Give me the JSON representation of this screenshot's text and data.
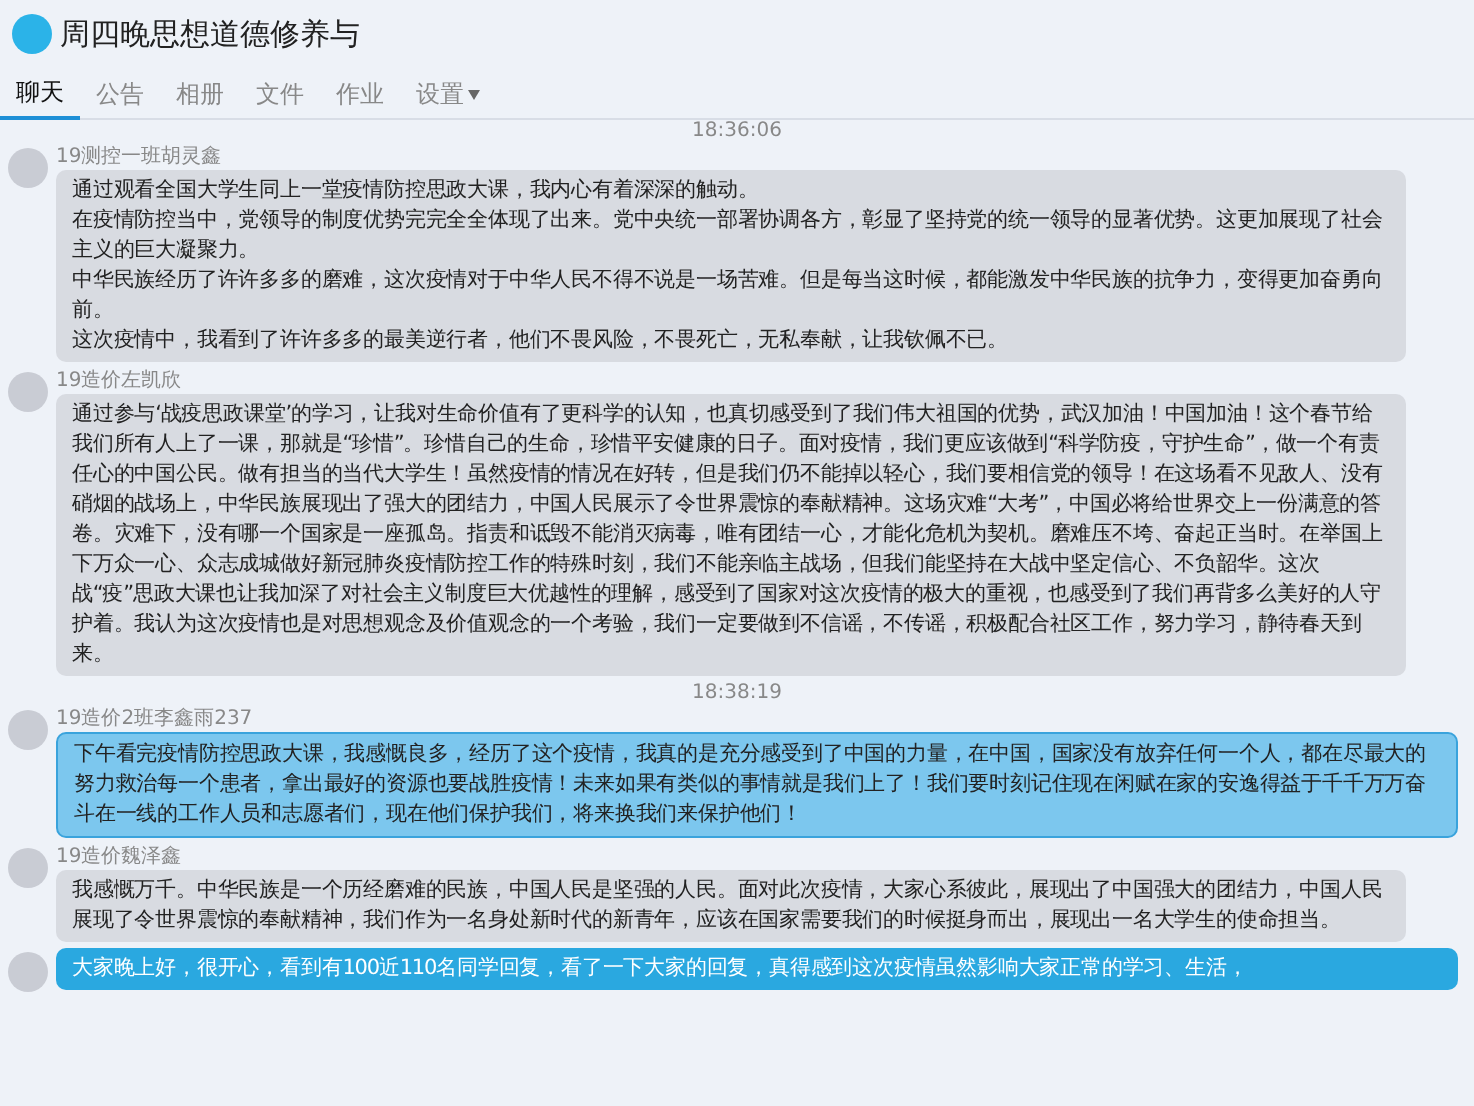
{
  "window": {
    "title": "周四晚思想道德修养与"
  },
  "tabs": [
    {
      "label": "聊天",
      "selected": true
    },
    {
      "label": "公告",
      "selected": false
    },
    {
      "label": "相册",
      "selected": false
    },
    {
      "label": "文件",
      "selected": false
    },
    {
      "label": "作业",
      "selected": false
    },
    {
      "label": "设置",
      "selected": false,
      "dropdown": true
    }
  ],
  "messages": [
    {
      "kind": "time",
      "text": "18:36:06"
    },
    {
      "kind": "other",
      "sender": "19测控一班胡灵鑫",
      "selected": false,
      "lines": [
        "通过观看全国大学生同上一堂疫情防控思政大课，我内心有着深深的触动。",
        "在疫情防控当中，党领导的制度优势完完全全体现了出来。党中央统一部署协调各方，彰显了坚持党的统一领导的显著优势。这更加展现了社会主义的巨大凝聚力。",
        "中华民族经历了许许多多的磨难，这次疫情对于中华人民不得不说是一场苦难。但是每当这时候，都能激发中华民族的抗争力，变得更加奋勇向前。",
        "这次疫情中，我看到了许许多多的最美逆行者，他们不畏风险，不畏死亡，无私奉献，让我钦佩不已。"
      ]
    },
    {
      "kind": "other",
      "sender": "19造价左凯欣",
      "selected": false,
      "lines": [
        "通过参与‘战疫思政课堂’的学习，让我对生命价值有了更科学的认知，也真切感受到了我们伟大祖国的优势，武汉加油！中国加油！这个春节给我们所有人上了一课，那就是“珍惜”。珍惜自己的生命，珍惜平安健康的日子。面对疫情，我们更应该做到“科学防疫，守护生命”，做一个有责任心的中国公民。做有担当的当代大学生！虽然疫情的情况在好转，但是我们仍不能掉以轻心，我们要相信党的领导！在这场看不见敌人、没有硝烟的战场上，中华民族展现出了强大的团结力，中国人民展示了令世界震惊的奉献精神。这场灾难“大考”，中国必将给世界交上一份满意的答卷。灾难下，没有哪一个国家是一座孤岛。指责和诋毁不能消灭病毒，唯有团结一心，才能化危机为契机。磨难压不垮、奋起正当时。在举国上下万众一心、众志成城做好新冠肺炎疫情防控工作的特殊时刻，我们不能亲临主战场，但我们能坚持在大战中坚定信心、不负韶华。这次战“疫”思政大课也让我加深了对社会主义制度巨大优越性的理解，感受到了国家对这次疫情的极大的重视，也感受到了我们再背多么美好的人守护着。我认为这次疫情也是对思想观念及价值观念的一个考验，我们一定要做到不信谣，不传谣，积极配合社区工作，努力学习，静待春天到来。"
      ]
    },
    {
      "kind": "time",
      "text": "18:38:19"
    },
    {
      "kind": "other",
      "sender": "19造价2班李鑫雨237",
      "selected": true,
      "lines": [
        "下午看完疫情防控思政大课，我感慨良多，经历了这个疫情，我真的是充分感受到了中国的力量，在中国，国家没有放弃任何一个人，都在尽最大的努力救治每一个患者，拿出最好的资源也要战胜疫情！未来如果有类似的事情就是我们上了！我们要时刻记住现在闲赋在家的安逸得益于千千万万奋斗在一线的工作人员和志愿者们，现在他们保护我们，将来换我们来保护他们！"
      ]
    },
    {
      "kind": "other",
      "sender": "19造价魏泽鑫",
      "selected": false,
      "lines": [
        "我感慨万千。中华民族是一个历经磨难的民族，中国人民是坚强的人民。面对此次疫情，大家心系彼此，展现出了中国强大的团结力，中国人民展现了令世界震惊的奉献精神，我们作为一名身处新时代的新青年，应该在国家需要我们的时候挺身而出，展现出一名大学生的使命担当。"
      ]
    },
    {
      "kind": "mine",
      "lines": [
        "大家晚上好，很开心，看到有100近110名同学回复，看了一下大家的回复，真得感到这次疫情虽然影响大家正常的学习、生活，"
      ]
    }
  ]
}
